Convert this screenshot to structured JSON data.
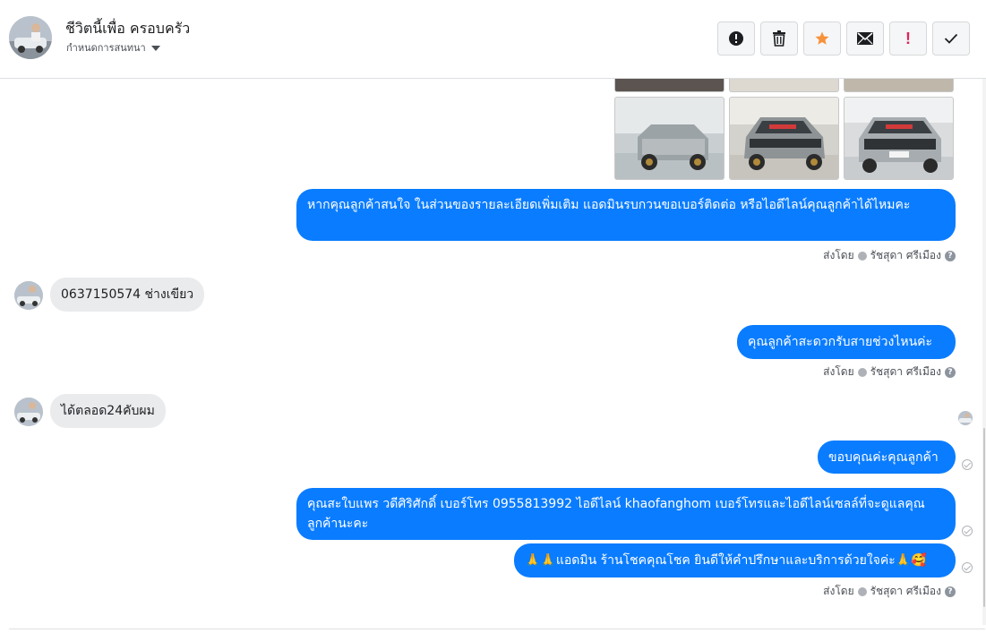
{
  "header": {
    "contact_name": "ชีวิตนี้เพื่อ ครอบครัว",
    "assign_label": "กำหนดการสนทนา"
  },
  "toolbar": {
    "buttons": [
      {
        "name": "spam-button",
        "icon": "alert-circle-icon"
      },
      {
        "name": "delete-button",
        "icon": "trash-icon"
      },
      {
        "name": "star-button",
        "icon": "star-icon",
        "color": "#f7923a"
      },
      {
        "name": "mark-unread-button",
        "icon": "envelope-icon"
      },
      {
        "name": "important-button",
        "label": "!",
        "color": "#e0245e"
      },
      {
        "name": "done-button",
        "icon": "check-icon"
      }
    ]
  },
  "messages": [
    {
      "id": "m1",
      "direction": "out",
      "text": "หากคุณลูกค้าสนใจ ในส่วนของรายละเอียดเพิ่มเติม แอดมินรบกวนขอเบอร์ติดต่อ หรือไอดีไลน์คุณลูกค้าได้ไหมคะ"
    },
    {
      "id": "m2",
      "direction": "in",
      "text": "0637150574 ช่างเขียว"
    },
    {
      "id": "m3",
      "direction": "out",
      "text": "คุณลูกค้าสะดวกรับสายช่วงไหนค่ะ"
    },
    {
      "id": "m4",
      "direction": "in",
      "text": "ได้ตลอด24คับผม"
    },
    {
      "id": "m5",
      "direction": "out",
      "text": "ขอบคุณค่ะคุณลูกค้า"
    },
    {
      "id": "m6",
      "direction": "out",
      "text": "คุณสะใบแพร วดีศิริศักดิ์ เบอร์โทร 0955813992  ไอดีไลน์  khaofanghom   เบอร์โทรและไอดีไลน์เซลล์ที่จะดูแลคุณลูกค้านะคะ"
    },
    {
      "id": "m7",
      "direction": "out",
      "text": "🙏🙏แอดมิน ร้านโชคคุณโชค ยินดีให้คำปรึกษาและบริการด้วยใจค่ะ🙏🥰"
    }
  ],
  "sent_by": {
    "prefix": "ส่งโดย",
    "agent": "รัชสุดา ศรีเมือง"
  },
  "colors": {
    "outgoing_bubble": "#0a7cff",
    "incoming_bubble": "#eaebed"
  }
}
